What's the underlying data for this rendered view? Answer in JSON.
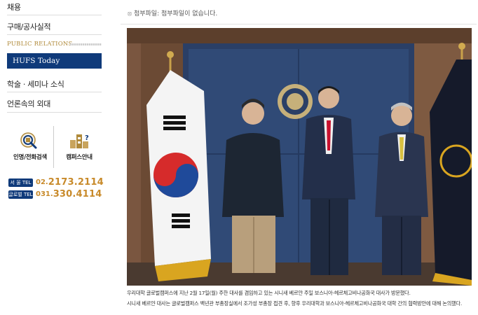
{
  "sidebar": {
    "items": [
      {
        "label": "채용"
      },
      {
        "label": "구매/공사실적"
      }
    ],
    "section_title": "PUBLIC RELATIONS",
    "active_item": "HUFS Today",
    "pr_items": [
      {
        "label": "학술 · 세미나 소식"
      },
      {
        "label": "언론속의 외대"
      }
    ],
    "quick_links": [
      {
        "label": "인명/전화검색",
        "icon": "phone-search-icon"
      },
      {
        "label": "캠퍼스안내",
        "icon": "campus-guide-icon"
      }
    ],
    "phones": [
      {
        "badge": "서 울 TEL",
        "prefix": "02.",
        "number": "2173.2114"
      },
      {
        "badge": "글로벌 TEL",
        "prefix": "031.",
        "number": "330.4114"
      }
    ]
  },
  "main": {
    "attachment": "첨부파일: 첨부파일이 없습니다.",
    "caption_lines": [
      "우리대학 글로벌캠퍼스에 지난 2월 17일(월) 주한 대사를 겸임하고 있는 시니새 베르얀 주일 보스니아-헤르체고비나공화국 대사가 방문했다.",
      "시니새 베르얀 대사는 글로벌캠퍼스 백년관 부총장실에서 조가성 부총장 접견 후, 향후 우리대학과 보스니아-헤르체고비나공화국 대학 간의 협력방안에 대해 논의했다."
    ]
  },
  "colors": {
    "navy": "#0f3a7a",
    "gold": "#c88a2a"
  }
}
